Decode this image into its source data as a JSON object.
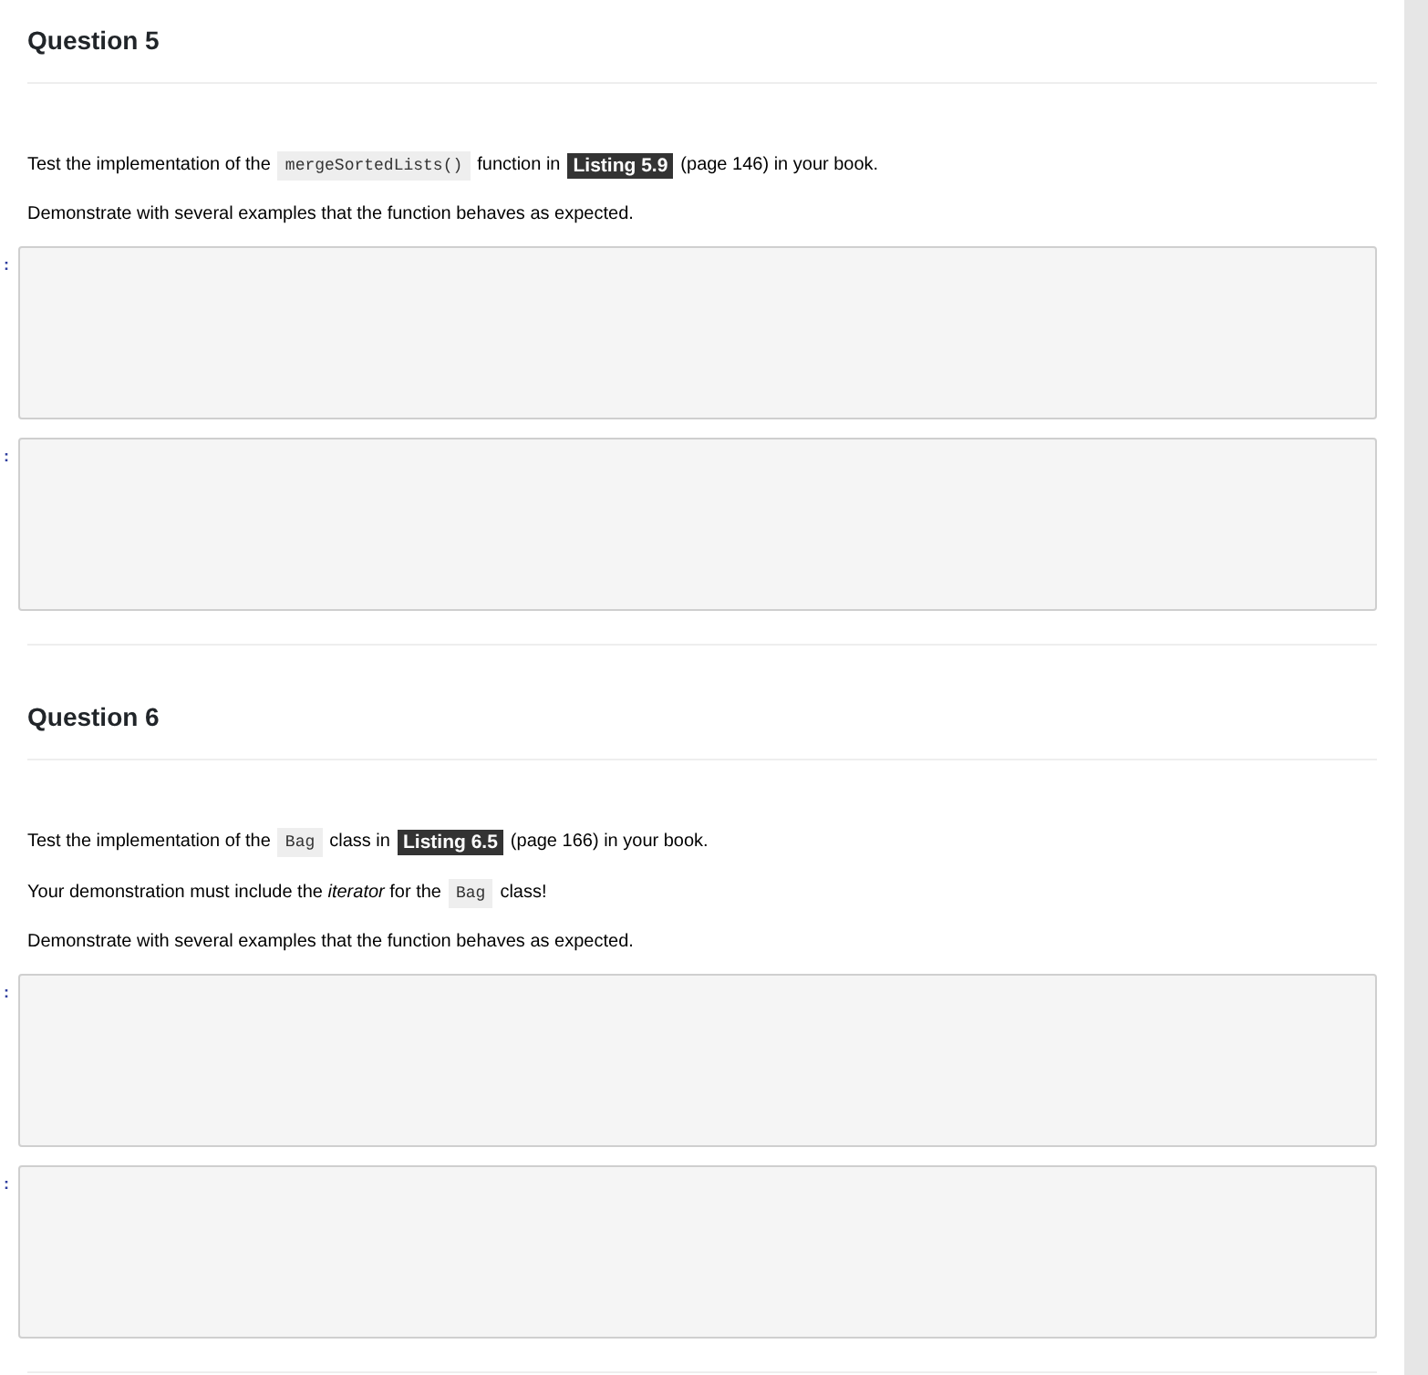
{
  "questions": [
    {
      "title": "Question 5",
      "paragraphs": [
        [
          {
            "kind": "text",
            "text": "Test the implementation of the"
          },
          {
            "kind": "code",
            "text": "mergeSortedLists()"
          },
          {
            "kind": "text",
            "text": "function in"
          },
          {
            "kind": "badge",
            "text": "Listing 5.9"
          },
          {
            "kind": "text",
            "text": "(page 146) in your book."
          }
        ],
        [
          {
            "kind": "text",
            "text": "Demonstrate with several examples that the function behaves as expected."
          }
        ]
      ],
      "cells": [
        {
          "prompt": ":"
        },
        {
          "prompt": ":"
        }
      ]
    },
    {
      "title": "Question 6",
      "paragraphs": [
        [
          {
            "kind": "text",
            "text": "Test the implementation of the"
          },
          {
            "kind": "code",
            "text": "Bag"
          },
          {
            "kind": "text",
            "text": "class in"
          },
          {
            "kind": "badge",
            "text": "Listing 6.5"
          },
          {
            "kind": "text",
            "text": "(page 166) in your book."
          }
        ],
        [
          {
            "kind": "text",
            "text": "Your demonstration must include the *iterator* for the"
          },
          {
            "kind": "code",
            "text": "Bag"
          },
          {
            "kind": "text",
            "text": "class!"
          }
        ],
        [
          {
            "kind": "text",
            "text": "Demonstrate with several examples that the function behaves as expected."
          }
        ]
      ],
      "cells": [
        {
          "prompt": ":"
        },
        {
          "prompt": ":"
        }
      ]
    }
  ]
}
